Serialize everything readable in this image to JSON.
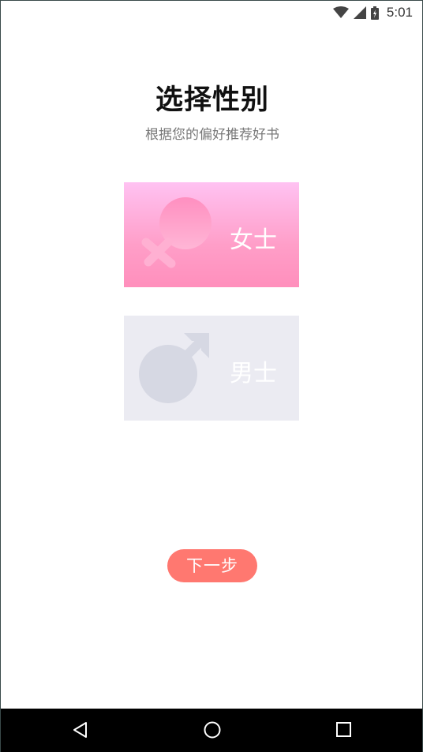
{
  "status_bar": {
    "time": "5:01",
    "icons": [
      "wifi-icon",
      "signal-icon",
      "battery-icon"
    ]
  },
  "header": {
    "title": "选择性别",
    "subtitle": "根据您的偏好推荐好书"
  },
  "gender_options": [
    {
      "label": "女士",
      "icon": "female-symbol-icon",
      "selected": true
    },
    {
      "label": "男士",
      "icon": "male-symbol-icon",
      "selected": false
    }
  ],
  "next_button": {
    "label": "下一步"
  },
  "nav_bar": {
    "buttons": [
      "back-icon",
      "home-icon",
      "recents-icon"
    ]
  },
  "colors": {
    "accent": "#ff7870",
    "female_card_top": "#ffc2f2",
    "female_card_bottom": "#ff8fbc",
    "male_card": "#ebebf2"
  }
}
